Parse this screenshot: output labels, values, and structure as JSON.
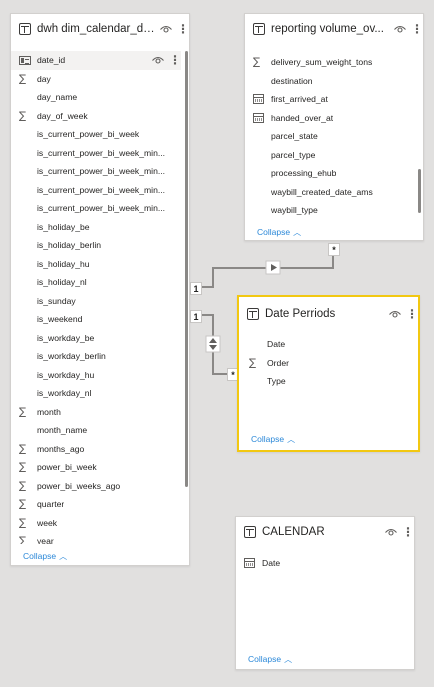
{
  "tables": {
    "dim_calendar": {
      "title": "dwh dim_calendar_da...",
      "fields": [
        {
          "label": "date_id",
          "icon": "id-icon",
          "highlighted": true
        },
        {
          "label": "day",
          "icon": "sigma-icon"
        },
        {
          "label": "day_name",
          "icon": ""
        },
        {
          "label": "day_of_week",
          "icon": "sigma-icon"
        },
        {
          "label": "is_current_power_bi_week",
          "icon": ""
        },
        {
          "label": "is_current_power_bi_week_min...",
          "icon": ""
        },
        {
          "label": "is_current_power_bi_week_min...",
          "icon": ""
        },
        {
          "label": "is_current_power_bi_week_min...",
          "icon": ""
        },
        {
          "label": "is_current_power_bi_week_min...",
          "icon": ""
        },
        {
          "label": "is_holiday_be",
          "icon": ""
        },
        {
          "label": "is_holiday_berlin",
          "icon": ""
        },
        {
          "label": "is_holiday_hu",
          "icon": ""
        },
        {
          "label": "is_holiday_nl",
          "icon": ""
        },
        {
          "label": "is_sunday",
          "icon": ""
        },
        {
          "label": "is_weekend",
          "icon": ""
        },
        {
          "label": "is_workday_be",
          "icon": ""
        },
        {
          "label": "is_workday_berlin",
          "icon": ""
        },
        {
          "label": "is_workday_hu",
          "icon": ""
        },
        {
          "label": "is_workday_nl",
          "icon": ""
        },
        {
          "label": "month",
          "icon": "sigma-icon"
        },
        {
          "label": "month_name",
          "icon": ""
        },
        {
          "label": "months_ago",
          "icon": "sigma-icon"
        },
        {
          "label": "power_bi_week",
          "icon": "sigma-icon"
        },
        {
          "label": "power_bi_weeks_ago",
          "icon": "sigma-icon"
        },
        {
          "label": "quarter",
          "icon": "sigma-icon"
        },
        {
          "label": "week",
          "icon": "sigma-icon"
        },
        {
          "label": "year",
          "icon": "sigma-icon"
        }
      ],
      "collapse_label": "Collapse"
    },
    "reporting_volume": {
      "title": "reporting volume_ov...",
      "fields": [
        {
          "label": "delivery_sum_weight_tons",
          "icon": "sigma-icon"
        },
        {
          "label": "destination",
          "icon": ""
        },
        {
          "label": "first_arrived_at",
          "icon": "calendar-icon"
        },
        {
          "label": "handed_over_at",
          "icon": "calendar-icon"
        },
        {
          "label": "parcel_state",
          "icon": ""
        },
        {
          "label": "parcel_type",
          "icon": ""
        },
        {
          "label": "processing_ehub",
          "icon": ""
        },
        {
          "label": "waybill_created_date_ams",
          "icon": ""
        },
        {
          "label": "waybill_type",
          "icon": ""
        }
      ],
      "collapse_label": "Collapse"
    },
    "date_perriods": {
      "title": "Date Perriods",
      "fields": [
        {
          "label": "Date",
          "icon": ""
        },
        {
          "label": "Order",
          "icon": "sigma-icon"
        },
        {
          "label": "Type",
          "icon": ""
        }
      ],
      "collapse_label": "Collapse"
    },
    "calendar": {
      "title": "CALENDAR",
      "fields": [
        {
          "label": "Date",
          "icon": "calendar-icon"
        }
      ],
      "collapse_label": "Collapse"
    }
  },
  "relationships": {
    "r1": {
      "from_cardinality": "1",
      "to_cardinality": "*"
    },
    "r2": {
      "from_cardinality": "1",
      "to_cardinality": "*"
    }
  },
  "colors": {
    "canvas": "#e1e0df",
    "selected_border": "#f2c811",
    "link": "#2b88d8",
    "line": "#8a8886"
  }
}
